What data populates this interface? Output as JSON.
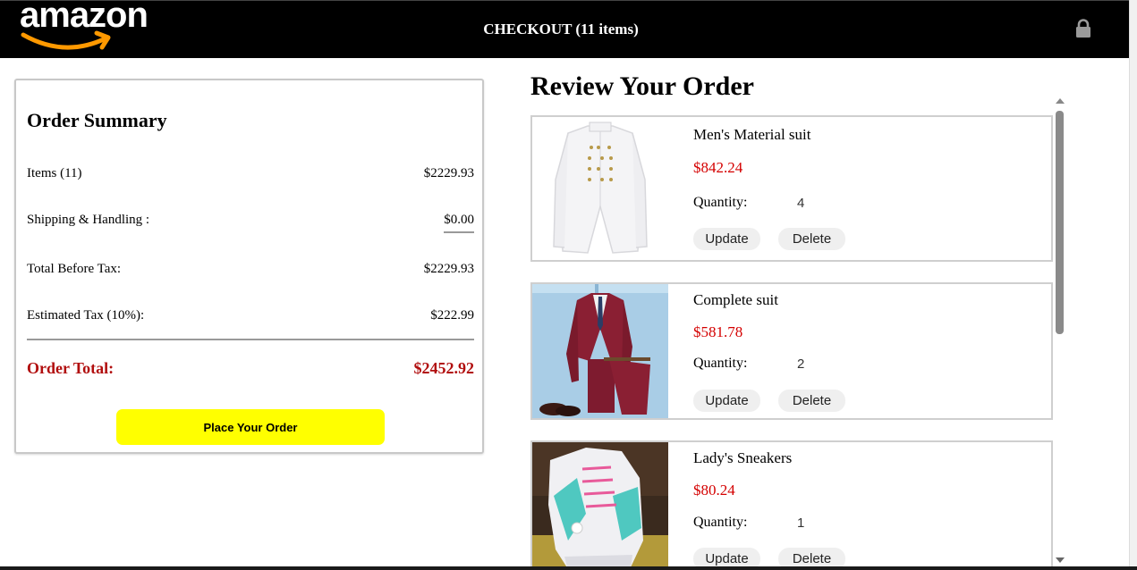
{
  "header": {
    "logo_text": "amazon",
    "checkout_title": "CHECKOUT (11 items)",
    "lock_icon": "lock-icon"
  },
  "summary": {
    "title": "Order Summary",
    "items_label": "Items (11)",
    "items_value": "$2229.93",
    "shipping_label": "Shipping & Handling :",
    "shipping_value": "$0.00",
    "before_tax_label": "Total Before Tax:",
    "before_tax_value": "$2229.93",
    "tax_label": "Estimated Tax (10%):",
    "tax_value": "$222.99",
    "total_label": "Order Total:",
    "total_value": "$2452.92",
    "place_order_label": "Place Your Order"
  },
  "review": {
    "title": "Review Your Order",
    "quantity_label": "Quantity:",
    "update_label": "Update",
    "delete_label": "Delete",
    "items": [
      {
        "name": "Men's Material suit",
        "price": "$842.24",
        "quantity": "4"
      },
      {
        "name": "Complete suit",
        "price": "$581.78",
        "quantity": "2"
      },
      {
        "name": "Lady's Sneakers",
        "price": "$80.24",
        "quantity": "1"
      }
    ]
  },
  "colors": {
    "header_bg": "#000000",
    "price_red": "#d40000",
    "total_red": "#b10e0e",
    "place_order_bg": "#ffff00"
  }
}
